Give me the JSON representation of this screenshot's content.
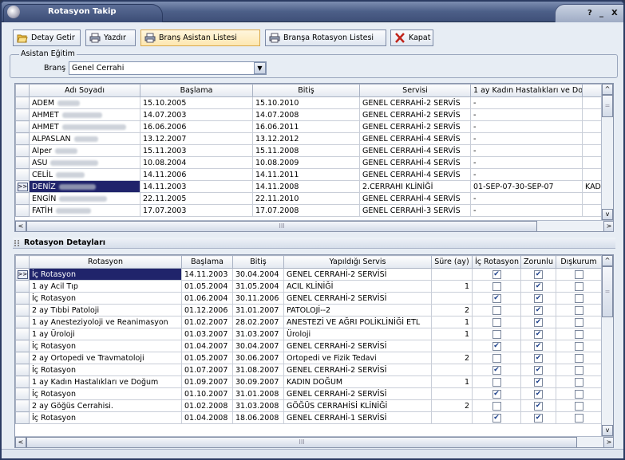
{
  "window": {
    "title": "Rotasyon Takip",
    "help": "?",
    "minimize": "_",
    "close": "X"
  },
  "toolbar": {
    "detay": "Detay Getir",
    "yazdir": "Yazdır",
    "brans_asistan": "Branş Asistan Listesi",
    "bransa_rotasyon": "Branşa Rotasyon Listesi",
    "kapat": "Kapat"
  },
  "filter": {
    "group_label": "Asistan Eğitim",
    "brans_label": "Branş",
    "brans_value": "Genel Cerrahi"
  },
  "grid1": {
    "headers": [
      "Adı Soyadı",
      "Başlama",
      "Bitiş",
      "Servisi",
      "1 ay Kadın Hastalıkları ve Do",
      ""
    ],
    "rows": [
      [
        "ADEM",
        "15.10.2005",
        "15.10.2010",
        "GENEL CERRAHİ-2 SERVİS",
        "-",
        ""
      ],
      [
        "AHMET",
        "14.07.2003",
        "14.07.2008",
        "GENEL CERRAHİ-2 SERVİS",
        "-",
        ""
      ],
      [
        "AHMET",
        "16.06.2006",
        "16.06.2011",
        "GENEL CERRAHİ-2 SERVİS",
        "-",
        ""
      ],
      [
        "ALPASLAN",
        "13.12.2007",
        "13.12.2012",
        "GENEL CERRAHİ-4 SERVİS",
        "-",
        ""
      ],
      [
        "Alper",
        "15.11.2003",
        "15.11.2008",
        "GENEL CERRAHİ-4 SERVİS",
        "-",
        ""
      ],
      [
        "ASU",
        "10.08.2004",
        "10.08.2009",
        "GENEL CERRAHİ-4 SERVİS",
        "-",
        ""
      ],
      [
        "CELİL",
        "14.11.2006",
        "14.11.2011",
        "GENEL CERRAHİ-4 SERVİS",
        "-",
        ""
      ],
      [
        "DENİZ",
        "14.11.2003",
        "14.11.2008",
        "2.CERRAHI KLİNİĞİ",
        "01-SEP-07-30-SEP-07",
        "KAD"
      ],
      [
        "ENGİN",
        "22.11.2005",
        "22.11.2010",
        "GENEL CERRAHİ-4 SERVİS",
        "-",
        ""
      ],
      [
        "FATİH",
        "17.07.2003",
        "17.07.2008",
        "GENEL CERRAHİ-3 SERVİS",
        "-",
        ""
      ]
    ]
  },
  "section2": {
    "title": "Rotasyon Detayları"
  },
  "grid2": {
    "headers": [
      "Rotasyon",
      "Başlama",
      "Bitiş",
      "Yapıldığı Servis",
      "Süre (ay)",
      "İç Rotasyon",
      "Zorunlu",
      "Dışkurum"
    ],
    "rows": [
      [
        "İç Rotasyon",
        "14.11.2003",
        "30.04.2004",
        "GENEL CERRAHİ-2 SERVİSİ",
        "",
        true,
        true,
        false
      ],
      [
        "1 ay Acil Tıp",
        "01.05.2004",
        "31.05.2004",
        "ACIL KLİNİĞİ",
        "1",
        false,
        true,
        false
      ],
      [
        "İç Rotasyon",
        "01.06.2004",
        "30.11.2006",
        "GENEL CERRAHİ-2 SERVİSİ",
        "",
        true,
        true,
        false
      ],
      [
        "2 ay Tıbbi Patoloji",
        "01.12.2006",
        "31.01.2007",
        "PATOLOJİ--2",
        "2",
        false,
        true,
        false
      ],
      [
        "1 ay Anesteziyoloji ve Reanimasyon",
        "01.02.2007",
        "28.02.2007",
        "ANESTEZİ VE AĞRI POLİKLİNİĞİ ETL",
        "1",
        false,
        true,
        false
      ],
      [
        "1 ay Üroloji",
        "01.03.2007",
        "31.03.2007",
        "Üroloji",
        "1",
        false,
        true,
        false
      ],
      [
        "İç Rotasyon",
        "01.04.2007",
        "30.04.2007",
        "GENEL CERRAHİ-2 SERVİSİ",
        "",
        true,
        true,
        false
      ],
      [
        "2 ay Ortopedi ve Travmatoloji",
        "01.05.2007",
        "30.06.2007",
        "Ortopedi ve Fizik Tedavi",
        "2",
        false,
        true,
        false
      ],
      [
        "İç Rotasyon",
        "01.07.2007",
        "31.08.2007",
        "GENEL CERRAHİ-2 SERVİSİ",
        "",
        true,
        true,
        false
      ],
      [
        "1 ay Kadın Hastalıkları ve Doğum",
        "01.09.2007",
        "30.09.2007",
        "KADIN DOĞUM",
        "1",
        false,
        true,
        false
      ],
      [
        "İç Rotasyon",
        "01.10.2007",
        "31.01.2008",
        "GENEL CERRAHİ-2 SERVİSİ",
        "",
        true,
        true,
        false
      ],
      [
        "2 ay Göğüs Cerrahisi.",
        "01.02.2008",
        "31.03.2008",
        "GÖĞÜS CERRAHİSİ KLİNİĞİ",
        "2",
        false,
        true,
        false
      ],
      [
        "İç Rotasyon",
        "01.04.2008",
        "18.06.2008",
        "GENEL CERRAHİ-1 SERVİSİ",
        "",
        true,
        true,
        false
      ]
    ]
  },
  "scroll": {
    "left": "<",
    "right": ">",
    "up": "^",
    "down": "v",
    "thumb": "III",
    "grip": "="
  },
  "indicator": ">>"
}
